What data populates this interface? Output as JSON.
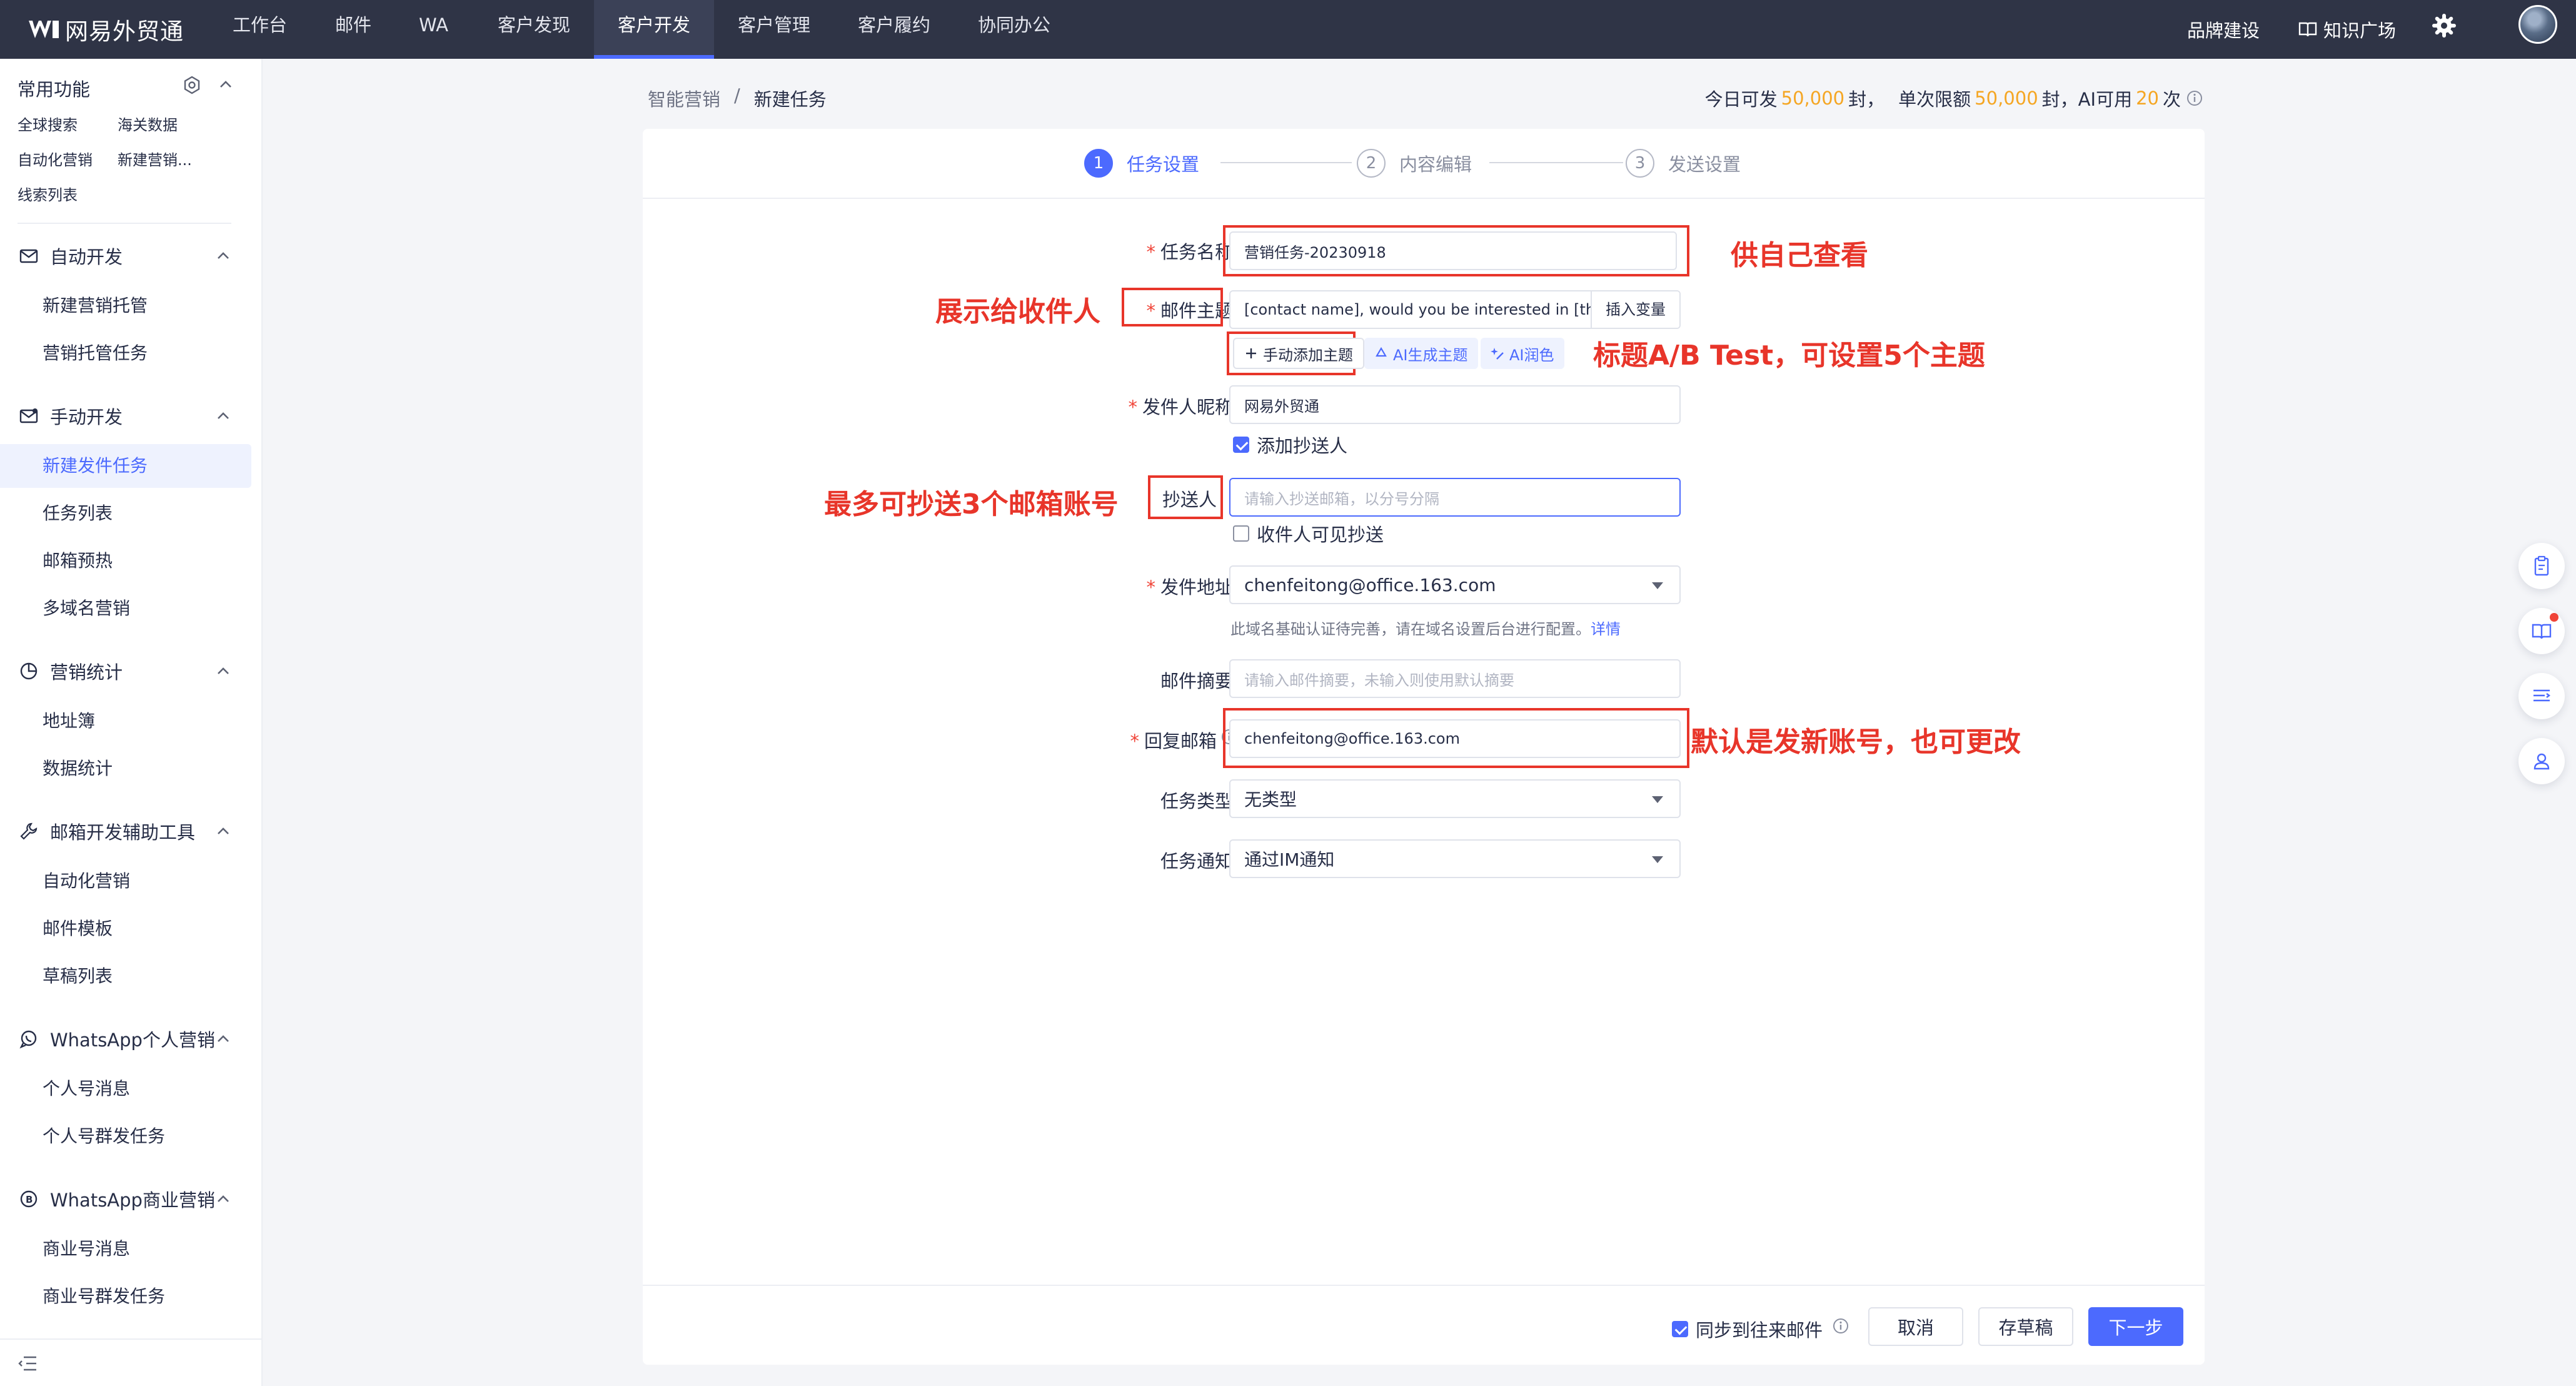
{
  "app": {
    "logo_text": "网易外贸通",
    "nav": [
      "工作台",
      "邮件",
      "WA",
      "客户发现",
      "客户开发",
      "客户管理",
      "客户履约",
      "协同办公"
    ],
    "nav_active_index": 4,
    "right_links": {
      "brand": "品牌建设",
      "knowledge": "知识广场"
    }
  },
  "sidebar": {
    "common_title": "常用功能",
    "quick_links": [
      "全球搜索",
      "海关数据",
      "自动化营销",
      "新建营销...",
      "线索列表"
    ],
    "groups": [
      {
        "title": "自动开发",
        "items": [
          "新建营销托管",
          "营销托管任务"
        ]
      },
      {
        "title": "手动开发",
        "items": [
          "新建发件任务",
          "任务列表",
          "邮箱预热",
          "多域名营销"
        ]
      },
      {
        "title": "营销统计",
        "items": [
          "地址簿",
          "数据统计"
        ]
      },
      {
        "title": "邮箱开发辅助工具",
        "items": [
          "自动化营销",
          "邮件模板",
          "草稿列表"
        ]
      },
      {
        "title": "WhatsApp个人营销",
        "items": [
          "个人号消息",
          "个人号群发任务"
        ]
      },
      {
        "title": "WhatsApp商业营销",
        "items": [
          "商业号消息",
          "商业号群发任务"
        ]
      }
    ],
    "active_item": "新建发件任务"
  },
  "breadcrumb": {
    "parent": "智能营销",
    "separator": "/",
    "current": "新建任务"
  },
  "quota": {
    "today_prefix": "今日可发",
    "today_value": "50,000",
    "unit_feng": "封，",
    "single_prefix": "单次限额",
    "single_value": "50,000",
    "ai_prefix": "AI可用",
    "ai_value": "20",
    "unit_ci": "次"
  },
  "steps": [
    {
      "num": "1",
      "label": "任务设置"
    },
    {
      "num": "2",
      "label": "内容编辑"
    },
    {
      "num": "3",
      "label": "发送设置"
    }
  ],
  "form": {
    "task_name": {
      "label": "任务名称",
      "value": "营销任务-20230918"
    },
    "subject": {
      "label": "邮件主题",
      "value": "[contact name], would you be interested in [th",
      "insert_var": "插入变量"
    },
    "subject_actions": {
      "manual": "手动添加主题",
      "ai_generate": "AI生成主题",
      "ai_polish": "AI润色"
    },
    "sender_nick": {
      "label": "发件人昵称",
      "value": "网易外贸通"
    },
    "add_cc": {
      "label": "添加抄送人",
      "checked": true
    },
    "cc": {
      "label": "抄送人",
      "placeholder": "请输入抄送邮箱，以分号分隔"
    },
    "cc_visible": {
      "label": "收件人可见抄送",
      "checked": false
    },
    "sender_addr": {
      "label": "发件地址",
      "value": "chenfeitong@office.163.com"
    },
    "domain_hint": {
      "text": "此域名基础认证待完善，请在域名设置后台进行配置。",
      "link": "详情"
    },
    "summary": {
      "label": "邮件摘要",
      "placeholder": "请输入邮件摘要，未输入则使用默认摘要"
    },
    "reply": {
      "label": "回复邮箱",
      "value": "chenfeitong@office.163.com"
    },
    "task_type": {
      "label": "任务类型",
      "value": "无类型"
    },
    "notify": {
      "label": "任务通知",
      "value": "通过IM通知"
    }
  },
  "annotations": {
    "task_name": "供自己查看",
    "subject": "展示给收件人",
    "ab_test": "标题A/B Test，可设置5个主题",
    "cc": "最多可抄送3个邮箱账号",
    "reply": "默认是发新账号，也可更改"
  },
  "footer": {
    "sync_label": "同步到往来邮件",
    "sync_checked": true,
    "cancel": "取消",
    "draft": "存草稿",
    "next": "下一步"
  },
  "colors": {
    "primary": "#4c6afe",
    "annotation": "#e8352a",
    "quota_number": "#f5a623",
    "topbar": "#2f3446"
  }
}
